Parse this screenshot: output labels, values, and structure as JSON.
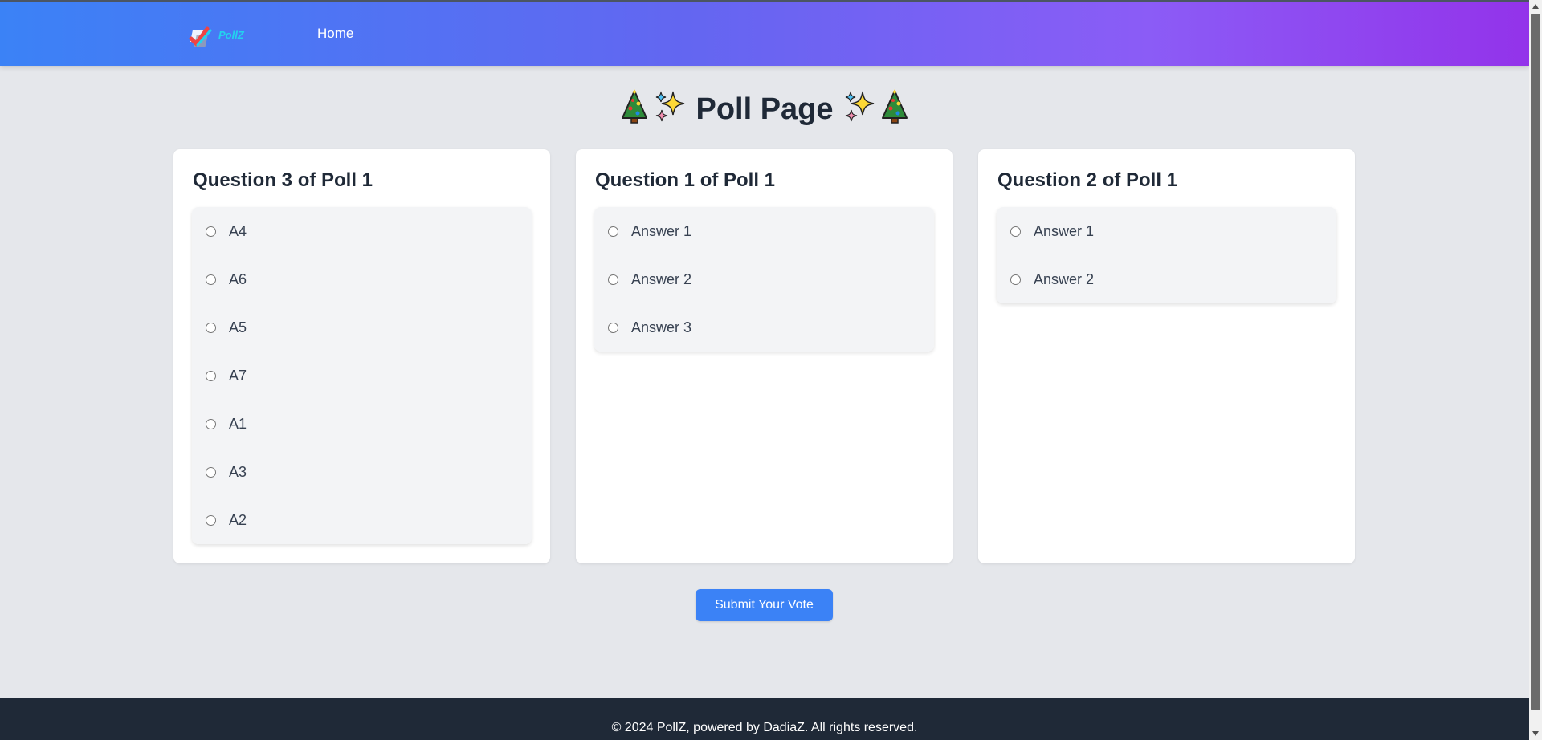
{
  "colors": {
    "header_gradient_start": "#3b82f6",
    "header_gradient_end": "#9333ea",
    "background": "#e5e7eb",
    "accent_button": "#3b82f6",
    "footer": "#1f2937"
  },
  "header": {
    "logo_text": "PollZ",
    "nav_home": "Home"
  },
  "main": {
    "title": "Poll Page",
    "title_left_emoji": "christmas-tree-icon + sparkles-icon",
    "title_right_emoji": "sparkles-icon + christmas-tree-icon",
    "questions": [
      {
        "title": "Question 3 of Poll 1",
        "options": [
          "A4",
          "A6",
          "A5",
          "A7",
          "A1",
          "A3",
          "A2"
        ]
      },
      {
        "title": "Question 1 of Poll 1",
        "options": [
          "Answer 1",
          "Answer 2",
          "Answer 3"
        ]
      },
      {
        "title": "Question 2 of Poll 1",
        "options": [
          "Answer 1",
          "Answer 2"
        ]
      }
    ],
    "submit_label": "Submit Your Vote"
  },
  "footer": {
    "text": "© 2024 PollZ, powered by DadiaZ. All rights reserved."
  }
}
